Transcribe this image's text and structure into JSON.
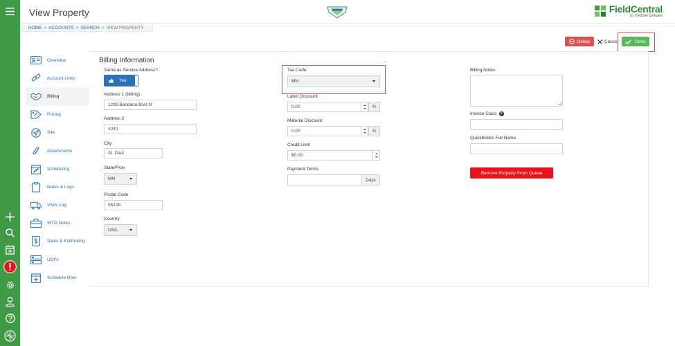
{
  "app": {
    "title": "View Property",
    "brand_name": "FieldCentral",
    "brand_sub": "by HindSite Software",
    "colors": {
      "rail": "#3e9a45",
      "link": "#2a6fb5",
      "primary": "#2a72b8",
      "danger": "#d9534f",
      "success": "#5cb85c"
    }
  },
  "rail": {
    "icons": [
      "menu-icon",
      "plus-icon",
      "search-icon",
      "calendar-add-icon",
      "alert-icon",
      "gear-icon",
      "user-icon",
      "help-icon",
      "brand-logo-icon"
    ]
  },
  "breadcrumb": {
    "items": [
      "HOME",
      "ACCOUNTS",
      "SEARCH",
      "VIEW PROPERTY"
    ],
    "separator": ">"
  },
  "actions": {
    "delete_label": "Delete",
    "cancel_label": "Cancel",
    "done_label": "Done"
  },
  "sidenav": {
    "items": [
      {
        "label": "Overview",
        "icon": "id-card-icon"
      },
      {
        "label": "Account Links",
        "icon": "link-icon"
      },
      {
        "label": "Billing",
        "icon": "handshake-icon",
        "active": true
      },
      {
        "label": "Pricing",
        "icon": "price-tag-icon"
      },
      {
        "label": "Site",
        "icon": "location-arrow-icon"
      },
      {
        "label": "Attachments",
        "icon": "paperclip-icon"
      },
      {
        "label": "Scheduling",
        "icon": "calendar-edit-icon"
      },
      {
        "label": "Notes & Logs",
        "icon": "clipboard-icon"
      },
      {
        "label": "Visits Log",
        "icon": "truck-icon"
      },
      {
        "label": "WTD Notes",
        "icon": "toolbox-icon"
      },
      {
        "label": "Sales & Estimating",
        "icon": "invoice-dollar-icon"
      },
      {
        "label": "UDFs",
        "icon": "fields-icon"
      },
      {
        "label": "Schedule Now",
        "icon": "calendar-plus-icon"
      }
    ]
  },
  "billing": {
    "section_title": "Billing Information",
    "same_as_service": {
      "label": "Same as Service Address?",
      "value": "Yes"
    },
    "address1": {
      "label": "Address 1 (billing)",
      "value": "1295 Bandana Blvd N"
    },
    "address2": {
      "label": "Address 2",
      "value": "#240"
    },
    "city": {
      "label": "City",
      "value": "St. Paul"
    },
    "state": {
      "label": "State/Prov",
      "value": "MN"
    },
    "postal": {
      "label": "Postal Code",
      "value": "55108"
    },
    "country": {
      "label": "Country",
      "value": "USA"
    },
    "tax_code": {
      "label": "Tax Code",
      "value": "MN"
    },
    "labor_discount": {
      "label": "Labor Discount",
      "value": "0.00",
      "suffix": "%"
    },
    "material_discount": {
      "label": "Material Discount",
      "value": "0.00",
      "suffix": "%"
    },
    "credit_limit": {
      "label": "Credit Limit",
      "value": "$0.00"
    },
    "payment_terms": {
      "label": "Payment Terms",
      "value": "",
      "suffix": "Days"
    },
    "billing_notes": {
      "label": "Billing Notes",
      "value": ""
    },
    "invoice_class": {
      "label": "Invoice Class",
      "value": ""
    },
    "qb_full_name": {
      "label": "QuickBooks Full Name",
      "value": ""
    },
    "remove_queue_label": "Remove Property From Queue"
  }
}
